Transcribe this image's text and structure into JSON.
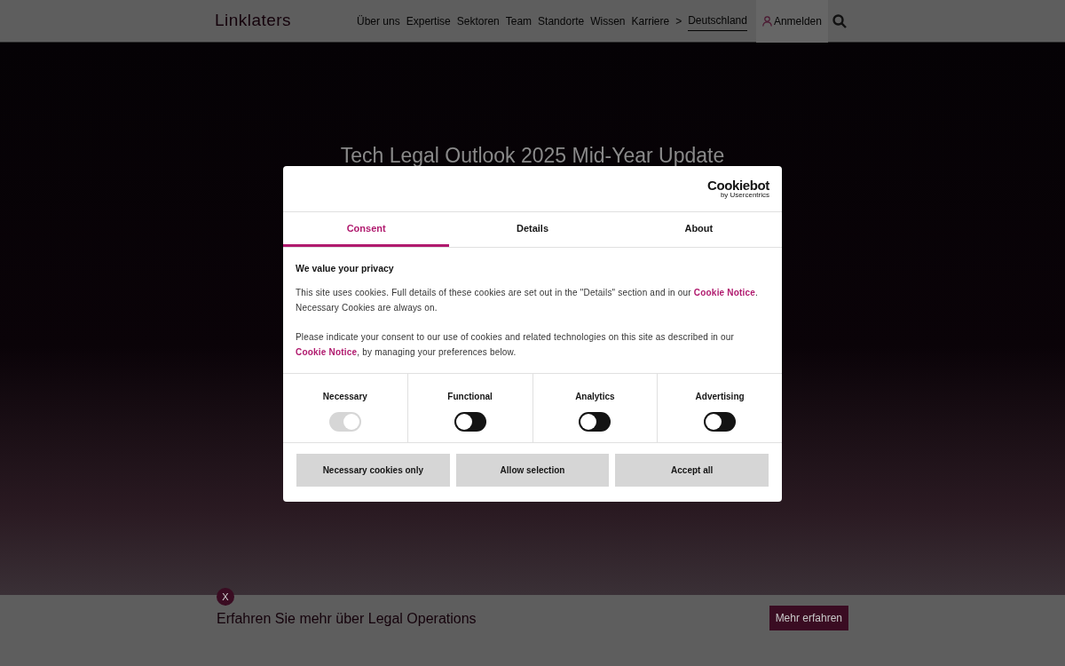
{
  "header": {
    "logo": "Linklaters",
    "nav": [
      {
        "label": "Über uns",
        "selected": false
      },
      {
        "label": "Expertise",
        "selected": false
      },
      {
        "label": "Sektoren",
        "selected": false
      },
      {
        "label": "Team",
        "selected": false
      },
      {
        "label": "Standorte",
        "selected": false
      },
      {
        "label": "Wissen",
        "selected": false
      },
      {
        "label": "Karriere",
        "selected": false
      },
      {
        "label": ">",
        "selected": false
      },
      {
        "label": "Deutschland",
        "selected": true
      }
    ],
    "login": "Anmelden"
  },
  "hero": {
    "title": "Tech Legal Outlook 2025 Mid-Year Update"
  },
  "cookie_dialog": {
    "brand": "Cookiebot",
    "brand_sub": "by Usercentrics",
    "tabs": [
      {
        "label": "Consent",
        "selected": true
      },
      {
        "label": "Details",
        "selected": false
      },
      {
        "label": "About",
        "selected": false
      }
    ],
    "heading": "We value your privacy",
    "paragraphs": [
      {
        "before": "This site uses cookies. Full details of these cookies are set out in the \"Details\" section and in our ",
        "link": "Cookie Notice",
        "after": ". Necessary Cookies are always on."
      },
      {
        "before": "Please indicate your consent to our use of cookies and related technologies on this site as described in our ",
        "link": "Cookie Notice",
        "after": ", by managing your preferences below."
      }
    ],
    "categories": [
      {
        "label": "Necessary",
        "checked": true,
        "disabled": true
      },
      {
        "label": "Functional",
        "checked": false,
        "disabled": false
      },
      {
        "label": "Analytics",
        "checked": false,
        "disabled": false
      },
      {
        "label": "Advertising",
        "checked": false,
        "disabled": false
      }
    ],
    "buttons": [
      "Necessary cookies only",
      "Allow selection",
      "Accept all"
    ]
  },
  "banner": {
    "close": "X",
    "text": "Erfahren Sie mehr über Legal Operations",
    "button": "Mehr erfahren"
  }
}
